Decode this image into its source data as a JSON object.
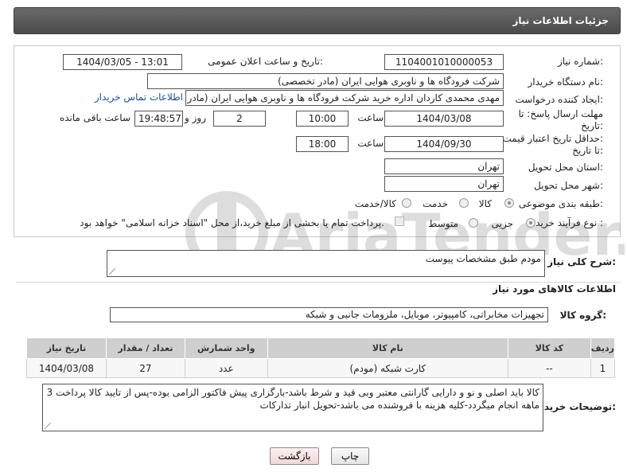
{
  "header": {
    "title": "جزئیات اطلاعات نیاز"
  },
  "form": {
    "need_number_label": "شماره نیاز:",
    "need_number": "1104001010000053",
    "announce_label": "تاریخ و ساعت اعلان عمومی:",
    "announce_value": "1404/03/05 - 13:01",
    "buyer_org_label": "نام دستگاه خریدار:",
    "buyer_org": "شرکت فرودگاه ها و ناوبری هوایی ایران (مادر تخصصی)",
    "creator_label": "ایجاد کننده درخواست:",
    "creator": "مهدی محمدی کاردان اداره خرید شرکت فرودگاه ها و ناوبری هوایی ایران (مادر تخ",
    "contact_link": "اطلاعات تماس خریدار",
    "deadline_label_line1": "مهلت ارسال پاسخ: تا",
    "deadline_label_line2": "تاریخ:",
    "deadline_date": "1404/03/08",
    "time_word": "ساعت",
    "deadline_time": "10:00",
    "days_value": "2",
    "days_word": "روز و",
    "remaining_time": "19:48:57",
    "remaining_label": "ساعت باقی مانده",
    "price_label_line1": "حداقل تاریخ اعتبار قیمت:",
    "price_label_line2": "تا تاریخ:",
    "price_date": "1404/09/30",
    "price_time": "18:00",
    "province_label": "استان محل تحویل:",
    "province": "تهران",
    "city_label": "شهر محل تحویل:",
    "city": "تهران",
    "category_label": "طبقه بندی موضوعی:",
    "category_options": [
      "کالا",
      "خدمت",
      "کالا/خدمت"
    ],
    "category_selected": "کالا",
    "process_label": "نوع فرآیند خرید :",
    "process_options": [
      "جزیی",
      "متوسط"
    ],
    "process_selected": "جزیی",
    "payment_note": "پرداخت تمام یا بخشی از مبلغ خرید،از محل \"اسناد خزانه اسلامی\" خواهد بود."
  },
  "summary": {
    "label": "شرح کلی نیاز:",
    "value": "مودم طبق مشخصات پیوست"
  },
  "goods_section": {
    "title": "اطلاعات کالاهای مورد نیاز",
    "group_label": "گروه کالا:",
    "group_value": "تجهیزات مخابراتی، کامپیوتر، موبایل، ملزومات جانبی و شبکه"
  },
  "table": {
    "headers": [
      "ردیف",
      "کد کالا",
      "نام کالا",
      "واحد شمارش",
      "تعداد / مقدار",
      "تاریخ نیاز"
    ],
    "rows": [
      [
        "1",
        "--",
        "کارت شبکه (مودم)",
        "عدد",
        "27",
        "1404/03/08"
      ]
    ]
  },
  "buyer_notes": {
    "label": "توضیحات خریدار:",
    "value": "کالا باید اصلی و نو و دارایی گارانتی معتبر وبی قید و شرط باشد-بارگزاری پیش فاکتور الزامی بوده-پس از تایید کالا پرداخت 3 ماهه انجام میگردد-کلیه هزینه با فروشنده می باشد-تحویل انبار تدارکات"
  },
  "buttons": {
    "print": "چاپ",
    "back": "بازگشت"
  },
  "watermark": {
    "brand": "AriaTender.net"
  },
  "colors": {
    "header_bg": "#555555",
    "link": "#1a4fa0",
    "back_button_bg": "#f7e3e3",
    "table_header_bg": "#cfcfcf"
  }
}
